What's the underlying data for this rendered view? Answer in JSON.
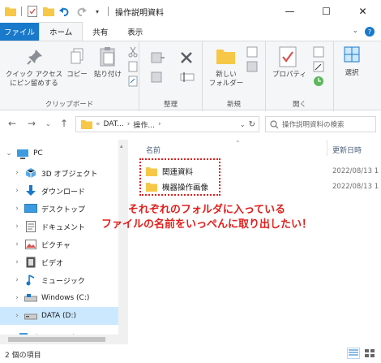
{
  "window": {
    "title": "操作説明資料",
    "minimize": "—",
    "maximize": "☐",
    "close": "✕"
  },
  "ribbon_tabs": [
    "ファイル",
    "ホーム",
    "共有",
    "表示"
  ],
  "ribbon": {
    "pin_label_1": "クイック アクセス",
    "pin_label_2": "にピン留めする",
    "copy_label": "コピー",
    "paste_label": "貼り付け",
    "clipboard_group": "クリップボード",
    "organize_group": "整理",
    "new_folder_label_1": "新しい",
    "new_folder_label_2": "フォルダー",
    "new_group": "新規",
    "properties_label": "プロパティ",
    "open_group": "開く",
    "select_label": "選択"
  },
  "navigation": {
    "back": "←",
    "forward": "→",
    "up": "↑",
    "address_segments": [
      "«",
      "DAT...",
      "›",
      "操作...",
      "›"
    ],
    "search_placeholder": "操作説明資料の検索"
  },
  "nav_pane": [
    {
      "label": "PC",
      "icon": "pc-icon",
      "expanded": true
    },
    {
      "label": "3D オブジェクト",
      "icon": "3d-objects-icon"
    },
    {
      "label": "ダウンロード",
      "icon": "download-icon"
    },
    {
      "label": "デスクトップ",
      "icon": "desktop-icon"
    },
    {
      "label": "ドキュメント",
      "icon": "document-icon"
    },
    {
      "label": "ピクチャ",
      "icon": "picture-icon"
    },
    {
      "label": "ビデオ",
      "icon": "video-icon"
    },
    {
      "label": "ミュージック",
      "icon": "music-icon"
    },
    {
      "label": "Windows (C:)",
      "icon": "drive-c-icon"
    },
    {
      "label": "DATA (D:)",
      "icon": "drive-d-icon",
      "selected": true
    },
    {
      "label": "ネットワーク",
      "icon": "network-icon"
    }
  ],
  "file_list": {
    "columns": [
      "名前",
      "更新日時"
    ],
    "rows": [
      {
        "name": "関連資料",
        "date": "2022/08/13 1"
      },
      {
        "name": "機器操作画像",
        "date": "2022/08/13 1"
      }
    ]
  },
  "annotation": {
    "line1": "それぞれのフォルダに入っている",
    "line2": "ファイルの名前をいっぺんに取り出したい！"
  },
  "status": {
    "item_count": "2 個の項目"
  },
  "colors": {
    "accent": "#1979ca",
    "annotation": "#e0201c",
    "selected": "#cce8ff",
    "folder": "#f7c748"
  }
}
